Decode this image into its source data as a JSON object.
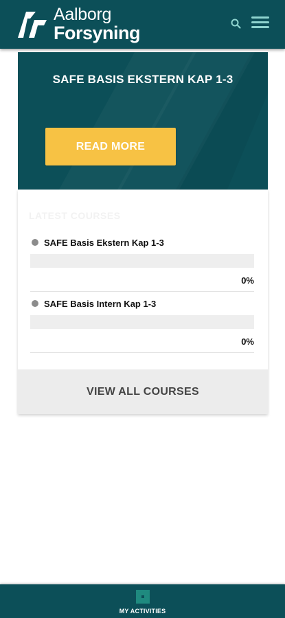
{
  "header": {
    "logo_line1": "Aalborg",
    "logo_line2": "Forsyning",
    "search_icon": "search-icon",
    "menu_icon": "hamburger-menu-icon"
  },
  "hero": {
    "title": "SAFE BASIS EKSTERN KAP 1-3",
    "button_label": "READ MORE"
  },
  "courses": {
    "heading": "LATEST COURSES",
    "items": [
      {
        "title": "SAFE Basis Ekstern Kap 1-3",
        "progress": 0,
        "progress_label": "0%"
      },
      {
        "title": "SAFE Basis Intern Kap 1-3",
        "progress": 0,
        "progress_label": "0%"
      }
    ],
    "view_all_label": "VIEW ALL COURSES"
  },
  "bottom_nav": {
    "activities_label": "MY ACTIVITIES",
    "activities_icon": "activities-icon"
  },
  "colors": {
    "brand_teal": "#0c4f58",
    "accent_yellow": "#f7c244",
    "menu_icon": "#8fd4cf"
  }
}
